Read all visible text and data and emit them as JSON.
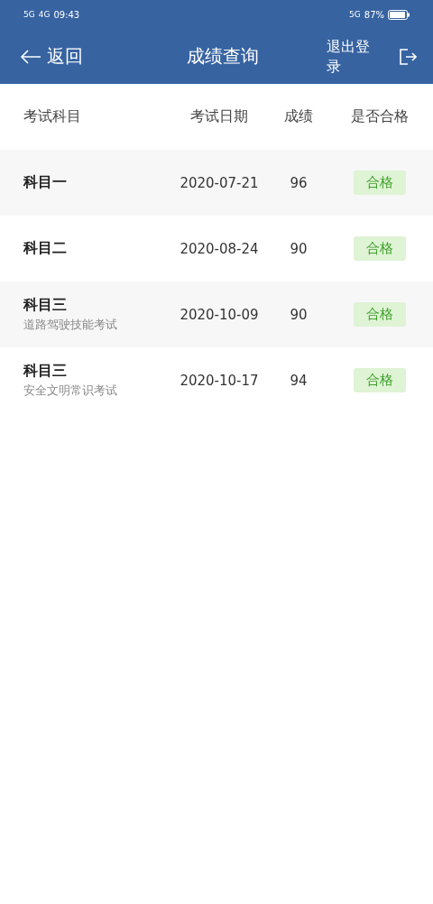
{
  "status_bar": {
    "left_signals": [
      "5G",
      "4G"
    ],
    "time": "09:43",
    "network": "5G",
    "battery": "87%"
  },
  "nav": {
    "back": "返回",
    "title": "成绩查询",
    "logout": "退出登录"
  },
  "table": {
    "columns": [
      "考试科目",
      "考试日期",
      "成绩",
      "是否合格"
    ],
    "rows": [
      {
        "subject": "科目一",
        "date": "2020-07-21",
        "score": "96",
        "result": "合格",
        "passed": true
      },
      {
        "subject": "科目二",
        "date": "2020-08-24",
        "score": "90",
        "result": "合格",
        "passed": true
      },
      {
        "subject": "科目三",
        "subtitle": "道路驾驶技能考试",
        "date": "2020-10-09",
        "score": "90",
        "result": "合格",
        "passed": true
      },
      {
        "subject": "科目三",
        "subtitle": "安全文明常识考试",
        "date": "2020-10-17",
        "score": "94",
        "result": "合格",
        "passed": true
      }
    ]
  }
}
